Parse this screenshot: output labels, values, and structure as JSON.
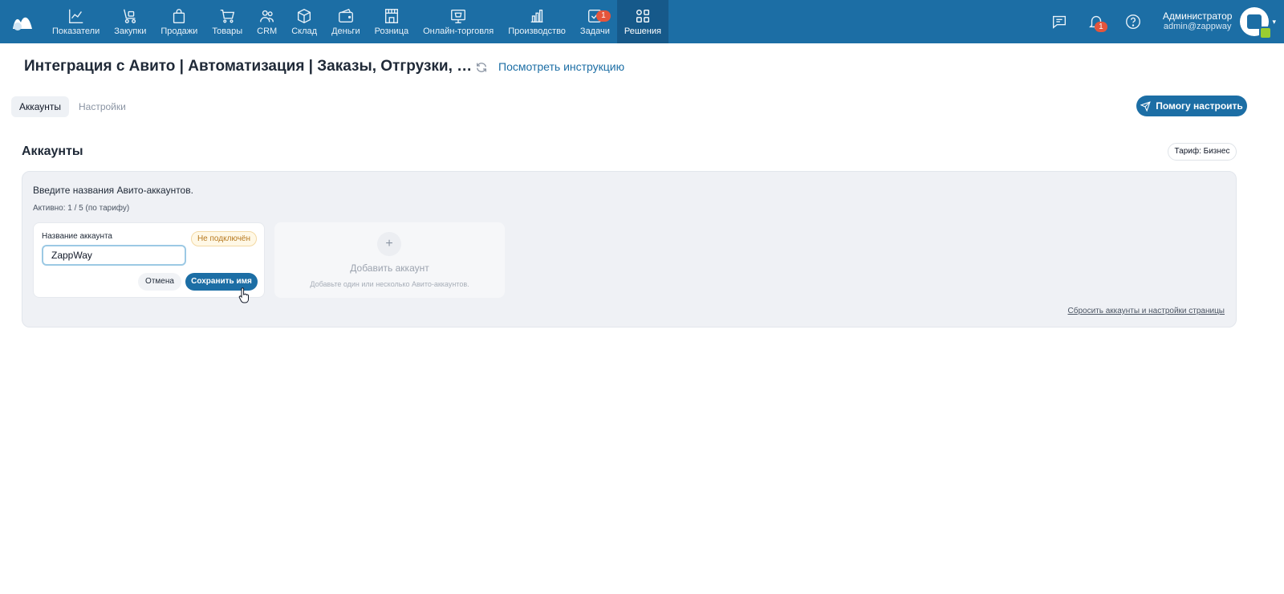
{
  "nav": {
    "items": [
      {
        "label": "Показатели",
        "icon": "chart-line-icon"
      },
      {
        "label": "Закупки",
        "icon": "dolly-icon"
      },
      {
        "label": "Продажи",
        "icon": "shopping-bag-icon"
      },
      {
        "label": "Товары",
        "icon": "cart-icon"
      },
      {
        "label": "CRM",
        "icon": "users-icon"
      },
      {
        "label": "Склад",
        "icon": "box-icon"
      },
      {
        "label": "Деньги",
        "icon": "wallet-icon"
      },
      {
        "label": "Розница",
        "icon": "store-icon"
      },
      {
        "label": "Онлайн-торговля",
        "icon": "online-shop-icon"
      },
      {
        "label": "Производство",
        "icon": "bar-chart-icon"
      },
      {
        "label": "Задачи",
        "icon": "checkbox-icon",
        "badge": "1"
      },
      {
        "label": "Решения",
        "icon": "grid-icon",
        "active": true
      }
    ]
  },
  "header_right": {
    "notifications_badge": "1",
    "user_name": "Администратор",
    "user_email": "admin@zappway"
  },
  "page": {
    "title": "Интеграция с Авито | Автоматизация | Заказы, Отгрузки, …",
    "instruction_link": "Посмотреть инструкцию"
  },
  "tabs": {
    "accounts": "Аккаунты",
    "settings": "Настройки"
  },
  "help_button": "Помогу настроить",
  "section": {
    "title": "Аккаунты",
    "tariff": "Тариф: Бизнес",
    "description": "Введите названия Авито-аккаунтов.",
    "active_count": "Активно: 1 / 5 (по тарифу)",
    "reset_link": "Сбросить аккаунты и настройки страницы"
  },
  "account_card": {
    "label": "Название аккаунта",
    "status": "Не подключён",
    "input_value": "ZappWay",
    "cancel": "Отмена",
    "save": "Сохранить имя"
  },
  "add_card": {
    "plus": "+",
    "title": "Добавить аккаунт",
    "subtitle": "Добавьте один или несколько Авито-аккаунтов."
  },
  "colors": {
    "brand": "#1c6ea5",
    "status_warning": "#b7791f",
    "badge": "#e4553c"
  }
}
